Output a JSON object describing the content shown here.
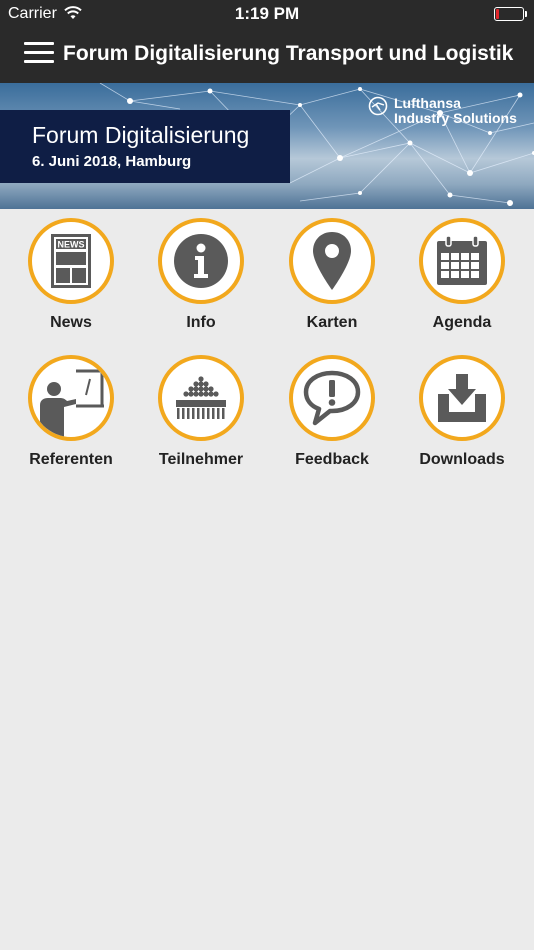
{
  "status_bar": {
    "carrier": "Carrier",
    "time": "1:19 PM",
    "battery_percent": 10,
    "battery_color": "#e0262b"
  },
  "nav": {
    "title": "Forum Digitalisierung Transport und Logistik"
  },
  "banner": {
    "title": "Forum Digitalisierung",
    "subtitle": "6. Juni 2018, Hamburg",
    "brand_line1": "Lufthansa",
    "brand_line2": "Industry Solutions"
  },
  "colors": {
    "accent": "#f2a81d",
    "icon": "#5a5a5a",
    "bar": "#2a2a2a",
    "background": "#ebebeb"
  },
  "menu": [
    {
      "label": "News",
      "icon": "news-icon"
    },
    {
      "label": "Info",
      "icon": "info-icon"
    },
    {
      "label": "Karten",
      "icon": "map-pin-icon"
    },
    {
      "label": "Agenda",
      "icon": "calendar-icon"
    },
    {
      "label": "Referenten",
      "icon": "speaker-icon"
    },
    {
      "label": "Teilnehmer",
      "icon": "audience-icon"
    },
    {
      "label": "Feedback",
      "icon": "feedback-icon"
    },
    {
      "label": "Downloads",
      "icon": "download-icon"
    }
  ]
}
